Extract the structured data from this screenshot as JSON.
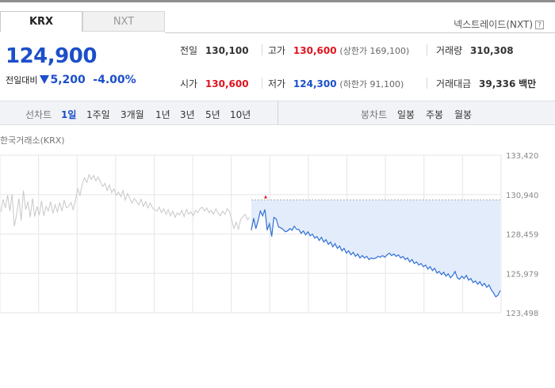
{
  "tabs": [
    {
      "label": "KRX",
      "active": true
    },
    {
      "label": "NXT",
      "active": false
    }
  ],
  "nxt_link": {
    "label": "넥스트레이드(NXT)",
    "help_icon": "question-box-icon",
    "help_glyph": "?"
  },
  "quote": {
    "price": "124,900",
    "change_label": "전일대비",
    "change_amount": "5,200",
    "change_percent": "-4.00%",
    "direction": "down"
  },
  "stats": {
    "prev_close": {
      "label": "전일",
      "value": "130,100"
    },
    "high": {
      "label": "고가",
      "value": "130,600",
      "sub": "(상한가 169,100)"
    },
    "volume": {
      "label": "거래량",
      "value": "310,308"
    },
    "open": {
      "label": "시가",
      "value": "130,600"
    },
    "low": {
      "label": "저가",
      "value": "124,300",
      "sub": "(하한가 91,100)"
    },
    "amount": {
      "label": "거래대금",
      "value": "39,336",
      "unit": "백만"
    }
  },
  "period_bar": {
    "line_label": "선차트",
    "line_items": [
      {
        "label": "1일",
        "selected": true
      },
      {
        "label": "1주일",
        "selected": false
      },
      {
        "label": "3개월",
        "selected": false
      },
      {
        "label": "1년",
        "selected": false
      },
      {
        "label": "3년",
        "selected": false
      },
      {
        "label": "5년",
        "selected": false
      },
      {
        "label": "10년",
        "selected": false
      }
    ],
    "candle_label": "봉차트",
    "candle_items": [
      {
        "label": "일봉"
      },
      {
        "label": "주봉"
      },
      {
        "label": "월봉"
      }
    ]
  },
  "chart_label": "한국거래소(KRX)",
  "colors": {
    "up": "#e0141e",
    "down": "#1c4fc9",
    "today_line": "#2f6fd6",
    "today_fill": "#e3ecfa",
    "prev_line": "#c8c8c8",
    "grid": "#e6e6e6",
    "tick_label": "#888888"
  },
  "chart_data": {
    "type": "line",
    "y_ticks": [
      "133,420",
      "130,940",
      "128,459",
      "125,979",
      "123,498"
    ],
    "ylim": [
      123498,
      133420
    ],
    "series": [
      {
        "values": [
          129850,
          130650,
          130100,
          130900,
          129900,
          130950,
          128950,
          129700,
          130700,
          129300,
          131200,
          130000,
          130500,
          129500,
          130700,
          129550,
          130200,
          129650,
          130550,
          129600,
          130200,
          129900,
          130500,
          129750,
          130300,
          129850,
          130450,
          129900,
          130600,
          130100,
          130200,
          130450,
          130000,
          130600,
          131300,
          130900,
          131600,
          132000,
          131700,
          132200,
          131900,
          132150,
          131800,
          132050,
          131750,
          131450,
          131650,
          131200,
          131550,
          131050,
          131300,
          130900,
          131100,
          130800,
          131200,
          130600,
          131000,
          130700,
          130400,
          130700,
          130500,
          130300,
          130650,
          130200,
          130500,
          130100,
          130400,
          130100,
          130000,
          129900,
          130150,
          129800,
          130050,
          129700,
          130000,
          129600,
          129900,
          129500,
          129800,
          129650,
          129950,
          129550,
          130000,
          129700,
          129850,
          129600,
          129950,
          129800,
          130050,
          130150,
          129900,
          130100,
          129800,
          129950,
          129700,
          130050,
          129800,
          129600,
          129900,
          129700,
          130050,
          129900,
          129350,
          128800,
          129200,
          128750,
          129400,
          129550,
          129700,
          129350,
          129500
        ]
      },
      {
        "values": [
          128700,
          129450,
          128800,
          129300,
          129900,
          129600,
          130000,
          128700,
          129100,
          128300,
          129500,
          129400,
          128900,
          128850,
          128750,
          128600,
          128650,
          128800,
          128700,
          128950,
          128750,
          128750,
          128500,
          128650,
          128400,
          128600,
          128350,
          128450,
          128200,
          128300,
          128050,
          128250,
          127950,
          128100,
          127800,
          127950,
          127650,
          127850,
          127550,
          127700,
          127400,
          127550,
          127250,
          127400,
          127150,
          127300,
          127050,
          127200,
          126950,
          127100,
          126950,
          127050,
          126850,
          126950,
          126900,
          126950,
          127050,
          127000,
          127100,
          127000,
          127150,
          127250,
          127100,
          127200,
          127050,
          127150,
          126950,
          127050,
          126850,
          126950,
          126700,
          126850,
          126600,
          126700,
          126500,
          126600,
          126400,
          126500,
          126250,
          126400,
          126150,
          126300,
          126000,
          126100,
          125900,
          126050,
          125800,
          125950,
          125700,
          125850,
          126100,
          125700,
          125600,
          125800,
          125650,
          125850,
          125550,
          125650,
          125400,
          125500,
          125300,
          125450,
          125200,
          125350,
          125100,
          125250,
          124950,
          124750,
          124500,
          124600,
          124900
        ]
      }
    ]
  }
}
